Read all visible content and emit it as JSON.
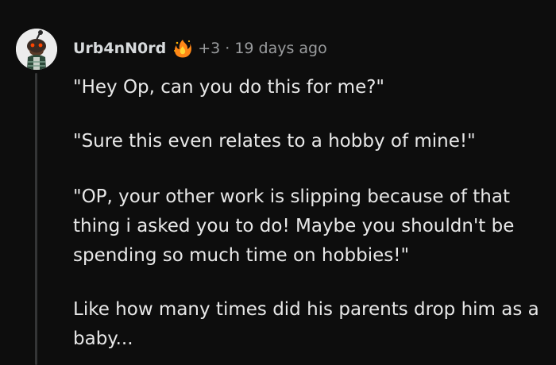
{
  "comment": {
    "author": "Urb4nN0rd",
    "karma_label": "+3",
    "separator": "·",
    "timestamp": "19 days ago",
    "avatar_icon": "snoo-avatar-icon",
    "flair_icon": "flame-award-icon",
    "paragraphs": [
      "\"Hey Op, can you do this for me?\"",
      "\"Sure this even relates to a hobby of mine!\"",
      "\"OP, your other work is slipping because of that thing i asked you to do! Maybe you shouldn't be spending so much time on hobbies!\"",
      "Like how many times did his parents drop him as a baby..."
    ]
  },
  "colors": {
    "background": "#0d0d0d",
    "text": "#e8e8e8",
    "meta": "#9a9c9e",
    "thread_line": "#343536"
  }
}
